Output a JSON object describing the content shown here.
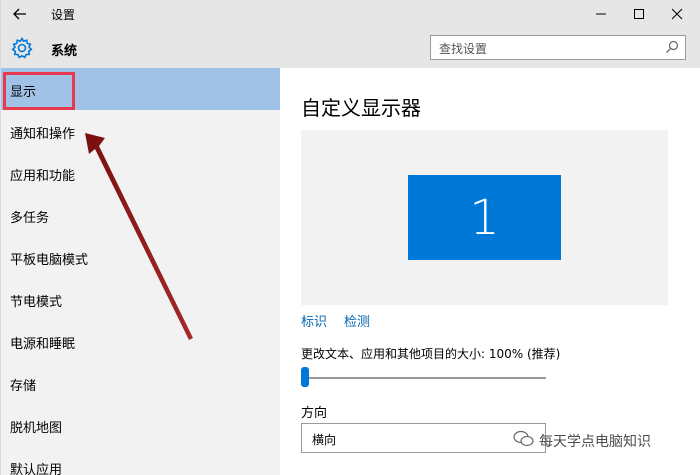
{
  "window": {
    "title": "设置"
  },
  "header": {
    "section_title": "系统",
    "search_placeholder": "查找设置"
  },
  "sidebar": {
    "items": [
      {
        "label": "显示",
        "selected": true
      },
      {
        "label": "通知和操作"
      },
      {
        "label": "应用和功能"
      },
      {
        "label": "多任务"
      },
      {
        "label": "平板电脑模式"
      },
      {
        "label": "节电模式"
      },
      {
        "label": "电源和睡眠"
      },
      {
        "label": "存储"
      },
      {
        "label": "脱机地图"
      },
      {
        "label": "默认应用"
      }
    ]
  },
  "main": {
    "title": "自定义显示器",
    "monitor_number": "1",
    "identify_link": "标识",
    "detect_link": "检测",
    "scale_label": "更改文本、应用和其他项目的大小: 100% (推荐)",
    "scale_percent": 0,
    "orientation_label": "方向",
    "orientation_value": "横向"
  },
  "watermark": {
    "text": "每天学点电脑知识"
  },
  "colors": {
    "accent": "#0078d7",
    "selected": "#9fc2e6",
    "highlight_box": "#e8384d",
    "arrow": "#8b1a1a"
  }
}
